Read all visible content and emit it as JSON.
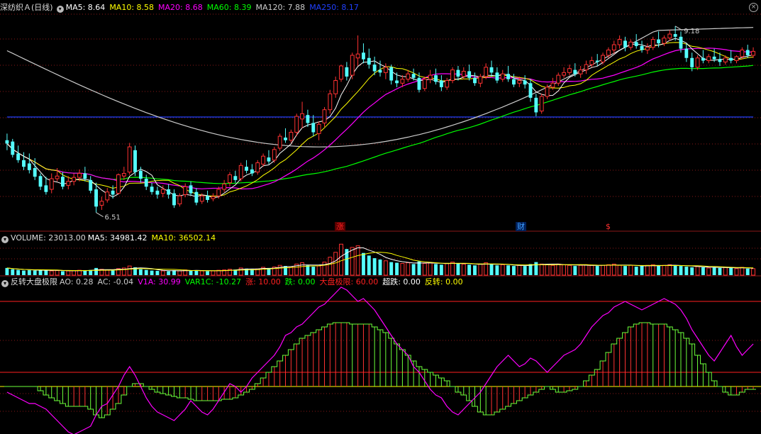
{
  "header": {
    "stock_title": "深纺织Ａ(日线)",
    "ma_items": [
      {
        "label": "MA5: 8.64",
        "color": "#ffffff"
      },
      {
        "label": "MA10: 8.58",
        "color": "#ffff00"
      },
      {
        "label": "MA20: 8.68",
        "color": "#ff00ff"
      },
      {
        "label": "MA60: 8.39",
        "color": "#00ff00"
      },
      {
        "label": "MA120: 7.88",
        "color": "#cccccc"
      },
      {
        "label": "MA250: 8.17",
        "color": "#2040ff"
      }
    ],
    "close_icon": "close-icon"
  },
  "volume_header": {
    "title": "VOLUME: 23013.00",
    "ma_items": [
      {
        "label": "MA5: 34981.42",
        "color": "#ffffff"
      },
      {
        "label": "MA10: 36502.14",
        "color": "#ffff00"
      }
    ]
  },
  "indicator_header": {
    "title": "反转大盘极限",
    "items": [
      {
        "label": "AO: 0.28",
        "color": "#cccccc"
      },
      {
        "label": "AC: -0.04",
        "color": "#cccccc"
      },
      {
        "label": "V1A: 30.99",
        "color": "#ff00ff"
      },
      {
        "label": "VAR1C: -10.27",
        "color": "#00ff00"
      },
      {
        "label": "涨: 10.00",
        "color": "#ff2020"
      },
      {
        "label": "跌: 0.00",
        "color": "#00ff00"
      },
      {
        "label": "大盘极限: 60.00",
        "color": "#ff2020"
      },
      {
        "label": "超跌: 0.00",
        "color": "#ffffff"
      },
      {
        "label": "反转: 0.00",
        "color": "#ffff00"
      }
    ]
  },
  "markers": [
    {
      "text": "涨",
      "color": "#ff2020",
      "bg": "#5a0000"
    },
    {
      "text": "财",
      "color": "#40a0ff",
      "bg": "#00205a"
    },
    {
      "text": "$",
      "color": "#ff3030",
      "bg": ""
    }
  ],
  "chart_data": {
    "type": "candlestick",
    "price_high_label": "9.18",
    "price_low_label": "6.51",
    "colors": {
      "up": "#ff3232",
      "down": "#54ffff",
      "ma5": "#ffffff",
      "ma10": "#ffff00",
      "ma20": "#ff00ff",
      "ma60": "#00ff00",
      "ma120": "#cccccc",
      "ma250": "#2040ff",
      "grid": "#8a1818"
    },
    "candles": [
      [
        7.6,
        7.7,
        7.55,
        7.45
      ],
      [
        7.58,
        7.62,
        7.38,
        7.34
      ],
      [
        7.4,
        7.52,
        7.3,
        7.26
      ],
      [
        7.3,
        7.42,
        7.2,
        7.15
      ],
      [
        7.25,
        7.4,
        7.15,
        7.1
      ],
      [
        7.18,
        7.33,
        7.05,
        7.0
      ],
      [
        7.06,
        7.1,
        6.9,
        6.85
      ],
      [
        6.92,
        7.05,
        6.82,
        6.78
      ],
      [
        6.86,
        7.1,
        7.02,
        6.8
      ],
      [
        7.02,
        7.18,
        7.06,
        6.98
      ],
      [
        7.05,
        7.12,
        6.9,
        6.86
      ],
      [
        6.92,
        7.06,
        6.98,
        6.86
      ],
      [
        6.98,
        7.1,
        7.04,
        6.92
      ],
      [
        7.04,
        7.16,
        7.1,
        6.98
      ],
      [
        7.1,
        7.2,
        7.02,
        6.98
      ],
      [
        7.0,
        7.06,
        6.84,
        6.8
      ],
      [
        6.86,
        6.96,
        6.6,
        6.51
      ],
      [
        6.62,
        6.75,
        6.68,
        6.55
      ],
      [
        6.7,
        6.88,
        6.82,
        6.66
      ],
      [
        6.84,
        6.92,
        6.78,
        6.72
      ],
      [
        6.8,
        7.1,
        7.08,
        6.78
      ],
      [
        7.06,
        7.2,
        7.1,
        7.0
      ],
      [
        7.12,
        7.56,
        7.5,
        7.08
      ],
      [
        7.45,
        7.52,
        7.12,
        7.06
      ],
      [
        7.14,
        7.2,
        7.02,
        6.96
      ],
      [
        7.02,
        7.08,
        6.9,
        6.85
      ],
      [
        6.9,
        6.96,
        6.82,
        6.78
      ],
      [
        6.84,
        6.9,
        6.78,
        6.72
      ],
      [
        6.8,
        6.92,
        6.86,
        6.74
      ],
      [
        6.86,
        6.94,
        6.78,
        6.72
      ],
      [
        6.8,
        6.86,
        6.62,
        6.58
      ],
      [
        6.64,
        6.8,
        6.76,
        6.6
      ],
      [
        6.78,
        6.95,
        6.9,
        6.74
      ],
      [
        6.92,
        6.98,
        6.8,
        6.76
      ],
      [
        6.82,
        6.88,
        6.66,
        6.62
      ],
      [
        6.68,
        6.8,
        6.76,
        6.64
      ],
      [
        6.76,
        6.84,
        6.7,
        6.66
      ],
      [
        6.72,
        6.8,
        6.75,
        6.68
      ],
      [
        6.76,
        6.9,
        6.86,
        6.72
      ],
      [
        6.86,
        7.0,
        6.94,
        6.82
      ],
      [
        6.96,
        7.12,
        7.08,
        6.9
      ],
      [
        7.06,
        7.14,
        7.0,
        6.96
      ],
      [
        7.02,
        7.26,
        7.22,
        6.98
      ],
      [
        7.2,
        7.3,
        7.14,
        7.1
      ],
      [
        7.16,
        7.24,
        7.1,
        7.06
      ],
      [
        7.12,
        7.3,
        7.26,
        7.08
      ],
      [
        7.24,
        7.4,
        7.36,
        7.2
      ],
      [
        7.34,
        7.45,
        7.28,
        7.24
      ],
      [
        7.3,
        7.5,
        7.46,
        7.26
      ],
      [
        7.48,
        7.7,
        7.66,
        7.44
      ],
      [
        7.64,
        7.78,
        7.6,
        7.56
      ],
      [
        7.6,
        7.76,
        7.72,
        7.56
      ],
      [
        7.72,
        8.0,
        7.96,
        7.66
      ],
      [
        7.92,
        8.18,
        8.0,
        7.78
      ],
      [
        7.98,
        8.06,
        7.86,
        7.8
      ],
      [
        7.86,
        7.98,
        7.72,
        7.66
      ],
      [
        7.7,
        7.88,
        7.84,
        7.6
      ],
      [
        7.86,
        8.1,
        8.06,
        7.8
      ],
      [
        8.06,
        8.36,
        8.3,
        8.0
      ],
      [
        8.3,
        8.56,
        8.5,
        8.24
      ],
      [
        8.52,
        8.74,
        8.72,
        8.48
      ],
      [
        8.7,
        8.78,
        8.56,
        8.5
      ],
      [
        8.58,
        8.92,
        8.88,
        8.52
      ],
      [
        8.84,
        9.18,
        8.9,
        8.72
      ],
      [
        8.92,
        9.06,
        8.82,
        8.76
      ],
      [
        8.84,
        8.98,
        8.74,
        8.68
      ],
      [
        8.74,
        8.86,
        8.64,
        8.58
      ],
      [
        8.66,
        8.8,
        8.62,
        8.56
      ],
      [
        8.62,
        8.76,
        8.7,
        8.52
      ],
      [
        8.7,
        8.74,
        8.5,
        8.44
      ],
      [
        8.5,
        8.62,
        8.46,
        8.4
      ],
      [
        8.46,
        8.58,
        8.52,
        8.4
      ],
      [
        8.52,
        8.66,
        8.6,
        8.48
      ],
      [
        8.6,
        8.68,
        8.54,
        8.5
      ],
      [
        8.54,
        8.62,
        8.36,
        8.32
      ],
      [
        8.38,
        8.56,
        8.52,
        8.34
      ],
      [
        8.52,
        8.66,
        8.58,
        8.46
      ],
      [
        8.58,
        8.68,
        8.48,
        8.44
      ],
      [
        8.5,
        8.58,
        8.4,
        8.34
      ],
      [
        8.4,
        8.54,
        8.5,
        8.36
      ],
      [
        8.5,
        8.7,
        8.66,
        8.46
      ],
      [
        8.66,
        8.72,
        8.56,
        8.5
      ],
      [
        8.56,
        8.7,
        8.64,
        8.52
      ],
      [
        8.64,
        8.74,
        8.54,
        8.5
      ],
      [
        8.54,
        8.62,
        8.46,
        8.42
      ],
      [
        8.46,
        8.6,
        8.56,
        8.4
      ],
      [
        8.56,
        8.76,
        8.7,
        8.52
      ],
      [
        8.7,
        8.8,
        8.62,
        8.56
      ],
      [
        8.62,
        8.7,
        8.5,
        8.46
      ],
      [
        8.52,
        8.66,
        8.6,
        8.48
      ],
      [
        8.6,
        8.72,
        8.52,
        8.48
      ],
      [
        8.52,
        8.6,
        8.44,
        8.4
      ],
      [
        8.46,
        8.56,
        8.5,
        8.4
      ],
      [
        8.5,
        8.58,
        8.44,
        8.38
      ],
      [
        8.46,
        8.52,
        8.24,
        8.18
      ],
      [
        8.24,
        8.3,
        8.02,
        7.96
      ],
      [
        8.04,
        8.3,
        8.26,
        8.0
      ],
      [
        8.26,
        8.44,
        8.4,
        8.22
      ],
      [
        8.4,
        8.54,
        8.46,
        8.36
      ],
      [
        8.46,
        8.62,
        8.58,
        8.42
      ],
      [
        8.58,
        8.7,
        8.62,
        8.54
      ],
      [
        8.62,
        8.74,
        8.68,
        8.58
      ],
      [
        8.66,
        8.76,
        8.6,
        8.56
      ],
      [
        8.6,
        8.72,
        8.66,
        8.54
      ],
      [
        8.66,
        8.8,
        8.74,
        8.6
      ],
      [
        8.74,
        8.86,
        8.8,
        8.7
      ],
      [
        8.8,
        8.9,
        8.78,
        8.72
      ],
      [
        8.78,
        8.92,
        8.88,
        8.74
      ],
      [
        8.88,
        9.0,
        8.96,
        8.84
      ],
      [
        8.96,
        9.1,
        9.04,
        8.9
      ],
      [
        9.04,
        9.18,
        9.12,
        8.98
      ],
      [
        9.1,
        9.16,
        9.0,
        8.94
      ],
      [
        9.0,
        9.12,
        9.08,
        8.96
      ],
      [
        9.08,
        9.2,
        9.02,
        8.98
      ],
      [
        9.02,
        9.1,
        8.96,
        8.92
      ],
      [
        8.96,
        9.06,
        9.0,
        8.9
      ],
      [
        9.0,
        9.16,
        9.12,
        8.96
      ],
      [
        9.12,
        9.24,
        9.06,
        9.0
      ],
      [
        9.06,
        9.18,
        9.14,
        9.02
      ],
      [
        9.14,
        9.26,
        9.2,
        9.1
      ],
      [
        9.2,
        9.32,
        9.16,
        9.1
      ],
      [
        9.16,
        9.24,
        8.98,
        8.92
      ],
      [
        8.98,
        9.06,
        8.84,
        8.78
      ],
      [
        8.84,
        8.92,
        8.7,
        8.64
      ],
      [
        8.7,
        8.88,
        8.84,
        8.66
      ],
      [
        8.84,
        8.96,
        8.8,
        8.76
      ],
      [
        8.8,
        8.9,
        8.86,
        8.76
      ],
      [
        8.86,
        8.98,
        8.82,
        8.78
      ],
      [
        8.82,
        8.92,
        8.78,
        8.72
      ],
      [
        8.78,
        8.88,
        8.84,
        8.74
      ],
      [
        8.84,
        8.96,
        8.8,
        8.76
      ],
      [
        8.8,
        8.88,
        8.86,
        8.76
      ],
      [
        8.86,
        9.0,
        8.96,
        8.82
      ],
      [
        8.96,
        9.04,
        8.88,
        8.84
      ],
      [
        8.88,
        9.0,
        8.94,
        8.84
      ]
    ],
    "volume": [
      22,
      18,
      16,
      14,
      15,
      14,
      17,
      15,
      13,
      14,
      12,
      13,
      14,
      15,
      14,
      16,
      22,
      18,
      15,
      14,
      20,
      22,
      28,
      24,
      18,
      16,
      14,
      13,
      13,
      12,
      15,
      13,
      16,
      14,
      15,
      13,
      12,
      13,
      15,
      16,
      18,
      17,
      22,
      20,
      18,
      19,
      24,
      22,
      25,
      30,
      28,
      26,
      34,
      38,
      30,
      26,
      28,
      40,
      55,
      70,
      95,
      80,
      85,
      90,
      68,
      60,
      52,
      48,
      44,
      40,
      38,
      36,
      38,
      34,
      42,
      36,
      38,
      34,
      32,
      36,
      40,
      36,
      34,
      32,
      30,
      34,
      38,
      34,
      30,
      32,
      30,
      28,
      30,
      28,
      34,
      40,
      34,
      32,
      30,
      34,
      32,
      30,
      28,
      30,
      32,
      30,
      28,
      30,
      32,
      34,
      30,
      28,
      30,
      26,
      28,
      30,
      32,
      28,
      30,
      32,
      30,
      28,
      26,
      24,
      26,
      24,
      22,
      24,
      22,
      24,
      22,
      20,
      24,
      20,
      20
    ],
    "indicator": {
      "levels": {
        "zhang": 10,
        "die": 0,
        "dapan_jixian": 60,
        "chaodie": 0,
        "fanzhuan": 0
      },
      "y_range": [
        -30,
        70
      ],
      "var1c": [
        0,
        0,
        0,
        0,
        0,
        0,
        -3,
        -6,
        -8,
        -10,
        -12,
        -14,
        -14,
        -14,
        -14,
        -16,
        -20,
        -22,
        -20,
        -16,
        -12,
        -6,
        0,
        2,
        2,
        0,
        -2,
        -4,
        -5,
        -6,
        -7,
        -8,
        -8,
        -9,
        -10,
        -10,
        -10,
        -10,
        -10,
        -9,
        -9,
        -8,
        -6,
        -4,
        -2,
        2,
        6,
        10,
        14,
        18,
        22,
        26,
        30,
        34,
        36,
        38,
        40,
        42,
        44,
        45,
        45,
        45,
        44,
        44,
        44,
        44,
        42,
        40,
        38,
        34,
        30,
        26,
        22,
        18,
        14,
        12,
        10,
        8,
        6,
        4,
        0,
        -4,
        -6,
        -10,
        -14,
        -18,
        -20,
        -20,
        -18,
        -16,
        -14,
        -12,
        -10,
        -8,
        -6,
        -4,
        -2,
        0,
        -2,
        -4,
        -4,
        -3,
        -2,
        0,
        4,
        8,
        12,
        18,
        24,
        30,
        34,
        38,
        42,
        44,
        45,
        45,
        44,
        44,
        44,
        42,
        40,
        38,
        34,
        30,
        22,
        16,
        10,
        4,
        0,
        -4,
        -6,
        -6,
        -4,
        -2,
        -2
      ],
      "v1a": [
        -4,
        -6,
        -8,
        -10,
        -12,
        -12,
        -14,
        -16,
        -20,
        -24,
        -28,
        -32,
        -34,
        -32,
        -30,
        -28,
        -20,
        -14,
        -12,
        -6,
        0,
        8,
        14,
        8,
        0,
        -8,
        -14,
        -18,
        -20,
        -22,
        -24,
        -20,
        -16,
        -10,
        -14,
        -18,
        -20,
        -16,
        -10,
        -4,
        2,
        0,
        -4,
        0,
        6,
        10,
        14,
        18,
        22,
        28,
        36,
        38,
        42,
        44,
        48,
        52,
        56,
        58,
        62,
        66,
        70,
        68,
        64,
        60,
        62,
        58,
        54,
        48,
        42,
        36,
        30,
        26,
        22,
        14,
        10,
        4,
        -2,
        -6,
        -8,
        -14,
        -18,
        -20,
        -16,
        -12,
        -8,
        -4,
        2,
        8,
        14,
        18,
        22,
        18,
        14,
        16,
        20,
        18,
        14,
        10,
        14,
        18,
        22,
        24,
        26,
        30,
        36,
        42,
        46,
        50,
        52,
        56,
        58,
        60,
        58,
        56,
        54,
        56,
        58,
        60,
        62,
        60,
        58,
        54,
        48,
        40,
        34,
        28,
        22,
        18,
        24,
        30,
        36,
        28,
        22,
        26,
        30
      ]
    }
  }
}
